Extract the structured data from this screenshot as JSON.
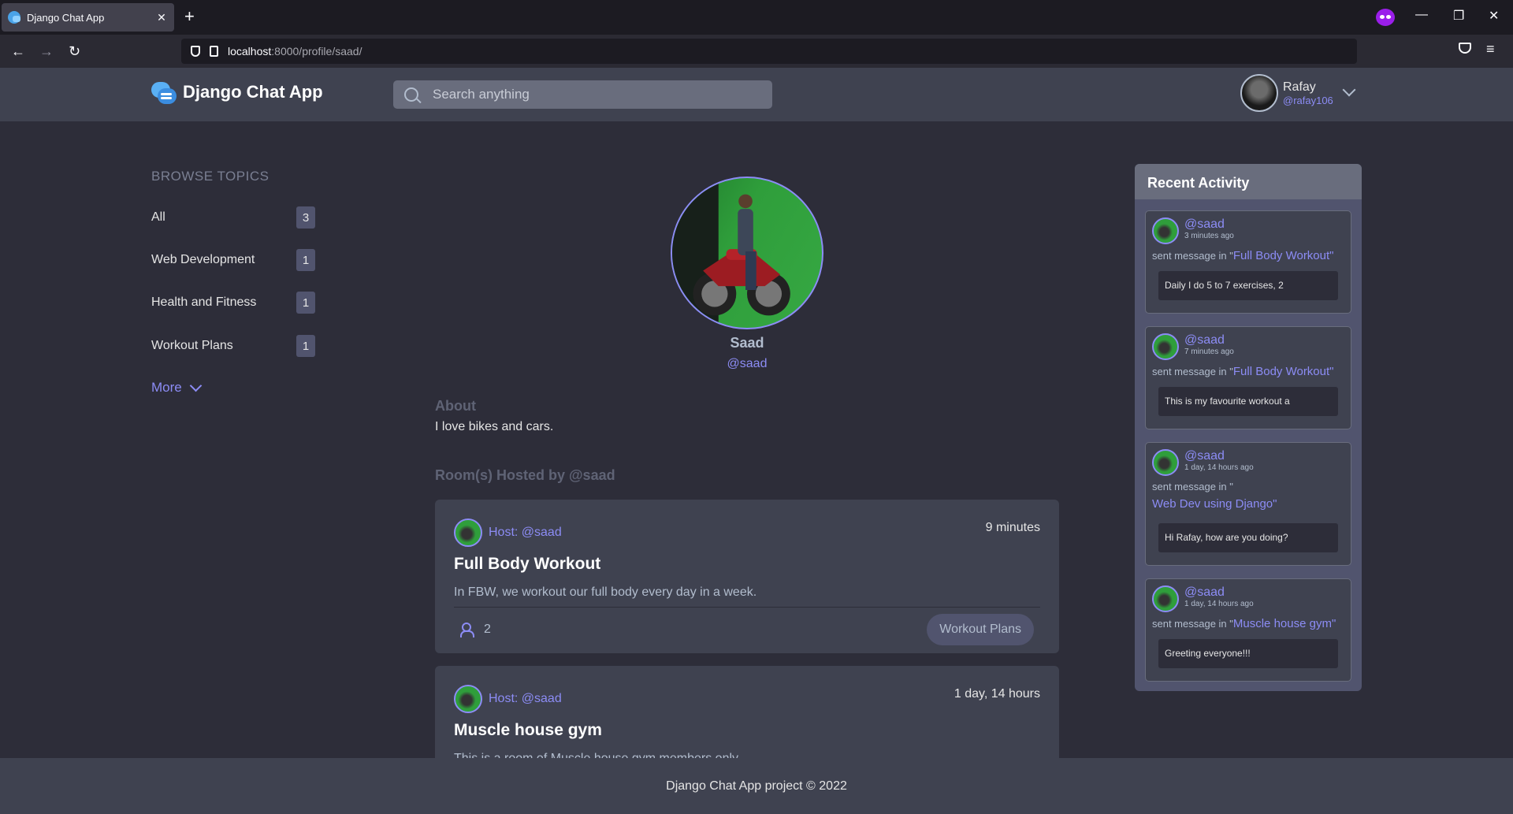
{
  "browser": {
    "tab_title": "Django Chat App",
    "tab_close": "✕",
    "new_tab": "+",
    "url_host": "localhost",
    "url_path": ":8000/profile/saad/",
    "back": "←",
    "forward": "→",
    "reload": "↻",
    "star": "☆",
    "menu": "≡",
    "minimize": "—",
    "restore": "❐",
    "close": "✕"
  },
  "header": {
    "app_name": "Django Chat App",
    "search_placeholder": "Search anything",
    "user_name": "Rafay",
    "user_handle": "@rafay106"
  },
  "sidebar": {
    "title": "BROWSE TOPICS",
    "topics": [
      {
        "name": "All",
        "count": "3"
      },
      {
        "name": "Web Development",
        "count": "1"
      },
      {
        "name": "Health and Fitness",
        "count": "1"
      },
      {
        "name": "Workout Plans",
        "count": "1"
      }
    ],
    "more_label": "More"
  },
  "profile": {
    "name": "Saad",
    "handle": "@saad",
    "about_title": "About",
    "about_text": "I love bikes and cars.",
    "hosted_title": "Room(s) Hosted by @saad"
  },
  "rooms": [
    {
      "host": "Host: @saad",
      "time": "9 minutes",
      "title": "Full Body Workout",
      "description": "In FBW, we workout our full body every day in a week.",
      "members": "2",
      "topic": "Workout Plans"
    },
    {
      "host": "Host: @saad",
      "time": "1 day, 14 hours",
      "title": "Muscle house gym",
      "description": "This is a room of Muscle house gym members only."
    }
  ],
  "activity": {
    "title": "Recent Activity",
    "items": [
      {
        "handle": "@saad",
        "time": "3 minutes ago",
        "sent": "sent message in \"",
        "room": "Full Body Workout\"",
        "message": "Daily I do 5 to 7 exercises, 2"
      },
      {
        "handle": "@saad",
        "time": "7 minutes ago",
        "sent": "sent message in \"",
        "room": "Full Body Workout\"",
        "message": "This is my favourite workout a"
      },
      {
        "handle": "@saad",
        "time": "1 day, 14 hours ago",
        "sent": "sent message in \"",
        "room": "Web Dev using Django\"",
        "message": "Hi Rafay, how are you doing?"
      },
      {
        "handle": "@saad",
        "time": "1 day, 14 hours ago",
        "sent": "sent message in \"",
        "room": "Muscle house gym\"",
        "message": "Greeting everyone!!!"
      }
    ]
  },
  "footer": {
    "text": "Django Chat App project © 2022"
  }
}
